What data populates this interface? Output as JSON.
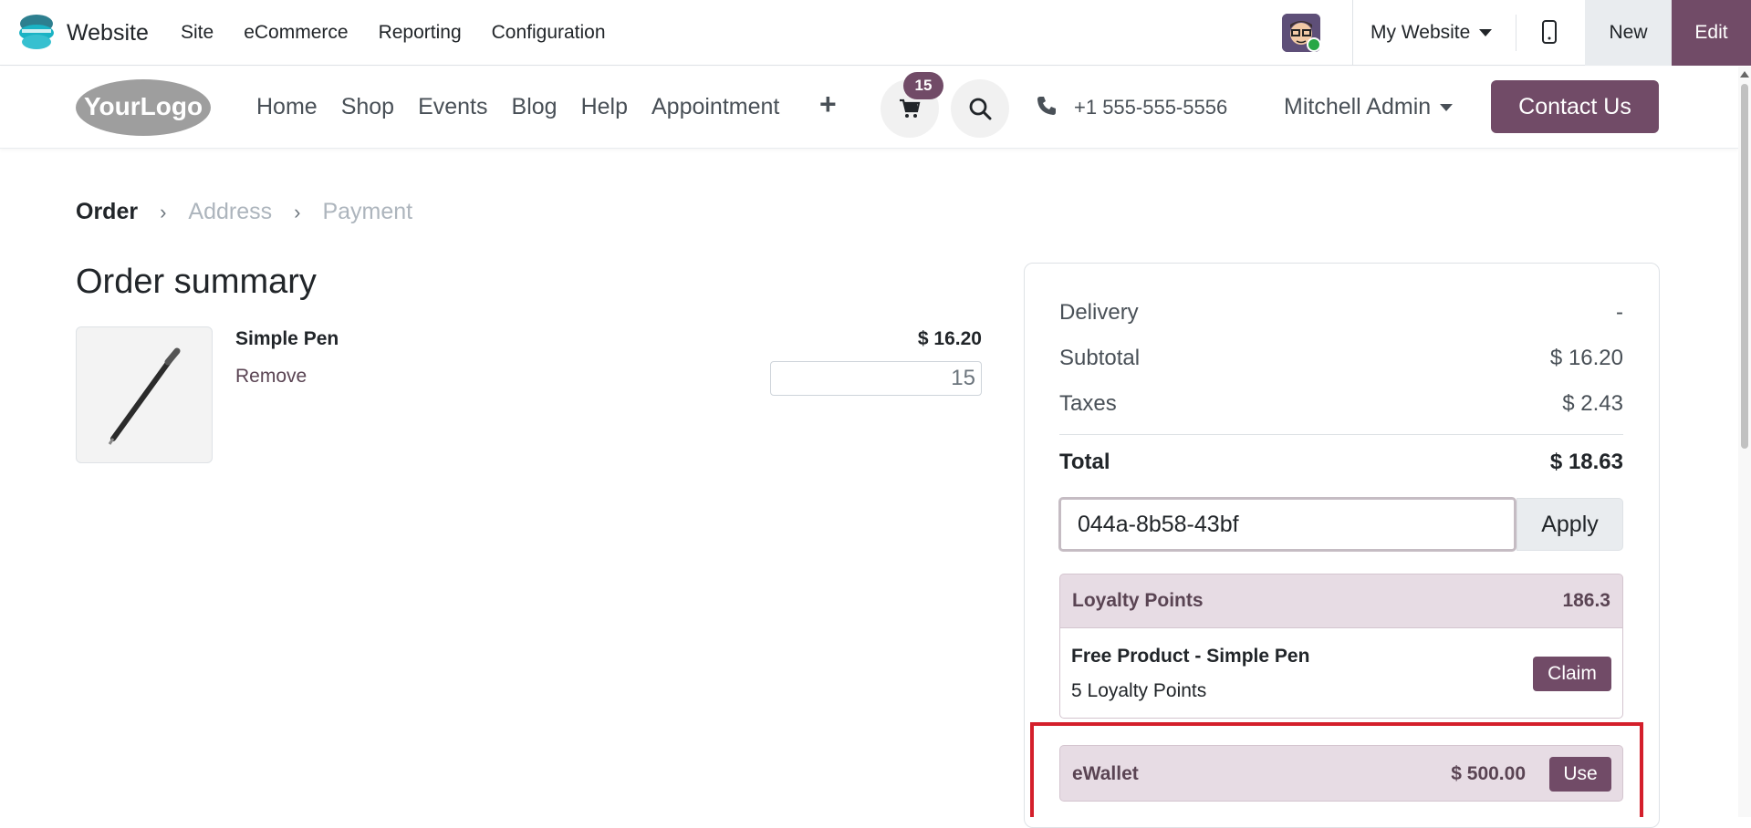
{
  "topbar": {
    "app_name": "Website",
    "menu": [
      "Site",
      "eCommerce",
      "Reporting",
      "Configuration"
    ],
    "website_select": "My Website",
    "new_label": "New",
    "edit_label": "Edit"
  },
  "header": {
    "logo_text": "YourLogo",
    "nav": [
      "Home",
      "Shop",
      "Events",
      "Blog",
      "Help",
      "Appointment"
    ],
    "cart_count": "15",
    "phone": "+1 555-555-5556",
    "user": "Mitchell Admin",
    "contact_label": "Contact Us"
  },
  "breadcrumb": {
    "steps": [
      "Order",
      "Address",
      "Payment"
    ]
  },
  "order": {
    "title": "Order summary",
    "product_name": "Simple Pen",
    "remove_label": "Remove",
    "price": "$ 16.20",
    "quantity": "15"
  },
  "summary": {
    "delivery_label": "Delivery",
    "delivery_value": "-",
    "subtotal_label": "Subtotal",
    "subtotal_value": "$ 16.20",
    "taxes_label": "Taxes",
    "taxes_value": "$ 2.43",
    "total_label": "Total",
    "total_value": "$ 18.63",
    "promo_code": "044a-8b58-43bf",
    "apply_label": "Apply"
  },
  "loyalty": {
    "label": "Loyalty Points",
    "points": "186.3",
    "reward_name": "Free Product - Simple Pen",
    "reward_cost": "5 Loyalty Points",
    "claim_label": "Claim"
  },
  "ewallet": {
    "label": "eWallet",
    "amount": "$ 500.00",
    "use_label": "Use"
  },
  "colors": {
    "brand": "#714b67",
    "highlight": "#d41f2b",
    "loyalty_bg": "#e7dce4"
  }
}
